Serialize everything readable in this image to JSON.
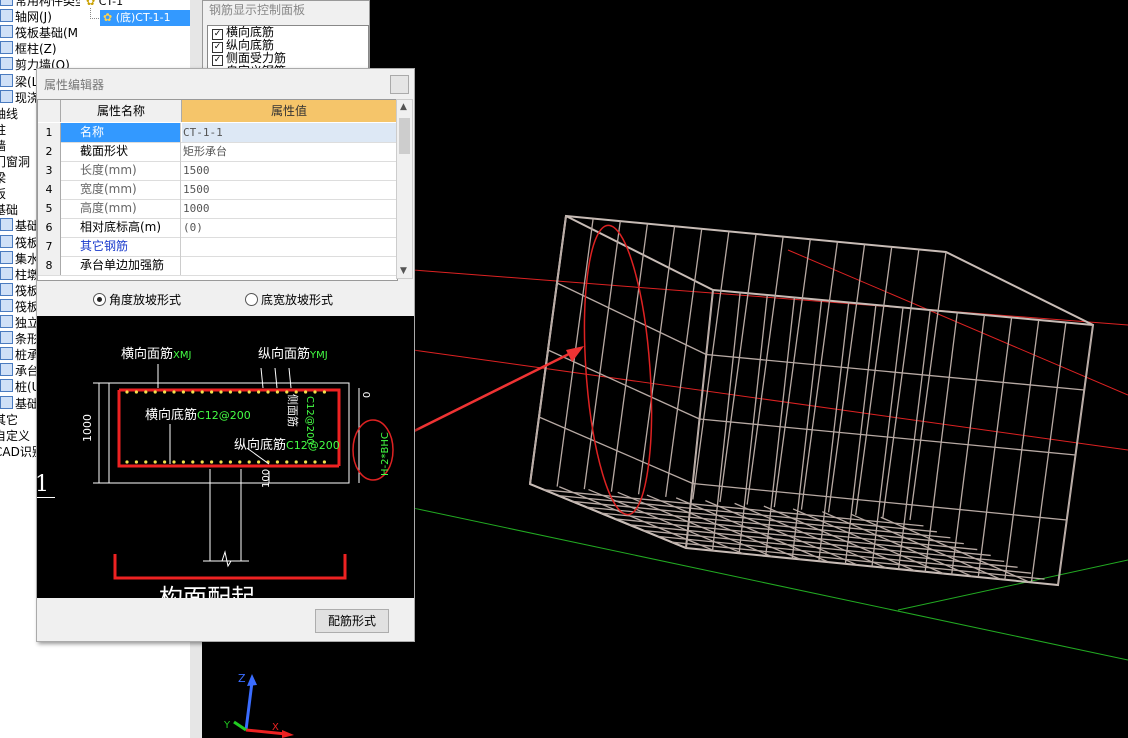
{
  "tree": {
    "items": [
      {
        "label": "常用构件类型",
        "icon": "folder-icon"
      },
      {
        "label": "轴网(J)",
        "icon": "grid-icon"
      },
      {
        "label": "筏板基础(M",
        "icon": "raft-foundation-icon"
      },
      {
        "label": "框柱(Z)",
        "icon": "column-icon"
      },
      {
        "label": "剪力墙(Q)",
        "icon": "shear-wall-icon"
      },
      {
        "label": "梁(L)",
        "icon": "beam-icon"
      },
      {
        "label": "现浇",
        "icon": "slab-icon"
      },
      {
        "label": "轴线",
        "icon": ""
      },
      {
        "label": "柱",
        "icon": ""
      },
      {
        "label": "墙",
        "icon": ""
      },
      {
        "label": "门窗洞",
        "icon": ""
      },
      {
        "label": "梁",
        "icon": ""
      },
      {
        "label": "板",
        "icon": ""
      },
      {
        "label": "基础",
        "icon": ""
      },
      {
        "label": "基础",
        "icon": "foundation-icon"
      },
      {
        "label": "筏板",
        "icon": "raft-icon"
      },
      {
        "label": "集水",
        "icon": "sump-icon"
      },
      {
        "label": "柱墩",
        "icon": "pier-icon"
      },
      {
        "label": "筏板",
        "icon": "raft-icon"
      },
      {
        "label": "筏板",
        "icon": "raft-icon"
      },
      {
        "label": "独立",
        "icon": "isolated-footing-icon"
      },
      {
        "label": "条形",
        "icon": "strip-footing-icon"
      },
      {
        "label": "桩承",
        "icon": "pile-cap-icon"
      },
      {
        "label": "承台",
        "icon": "cap-icon"
      },
      {
        "label": "桩(U",
        "icon": "pile-icon"
      },
      {
        "label": "基础",
        "icon": "foundation-icon"
      },
      {
        "label": "其它",
        "icon": ""
      },
      {
        "label": "自定义",
        "icon": ""
      },
      {
        "label": "CAD识别",
        "icon": ""
      }
    ]
  },
  "tree2": {
    "root": "CT-1",
    "selected": "(底)CT-1-1"
  },
  "rebar_panel": {
    "title": "钢筋显示控制面板",
    "items": [
      "横向底筋",
      "纵向底筋",
      "侧面受力筋",
      "自定义钢筋一"
    ]
  },
  "editor": {
    "title": "属性编辑器",
    "col_name": "属性名称",
    "col_value": "属性值",
    "rows": [
      {
        "n": "1",
        "name": "名称",
        "value": "CT-1-1"
      },
      {
        "n": "2",
        "name": "截面形状",
        "value": "矩形承台"
      },
      {
        "n": "3",
        "name": "长度(mm)",
        "value": "1500"
      },
      {
        "n": "4",
        "name": "宽度(mm)",
        "value": "1500"
      },
      {
        "n": "5",
        "name": "高度(mm)",
        "value": "1000"
      },
      {
        "n": "6",
        "name": "相对底标高(m)",
        "value": "(0)"
      },
      {
        "n": "7",
        "name": "其它钢筋",
        "value": ""
      },
      {
        "n": "8",
        "name": "承台单边加强筋",
        "value": ""
      }
    ],
    "radio_1": "角度放坡形式",
    "radio_2": "底宽放坡形式",
    "config_button": "配筋形式",
    "colors": {
      "header_value_bg": "#f5c56a",
      "selected_row": "#3399ff",
      "link_text": "#1a3acc"
    }
  },
  "preview": {
    "label_top_h": "横向面筋",
    "label_top_h_code": "XMJ",
    "label_top_v": "纵向面筋",
    "label_top_v_code": "YMJ",
    "label_bottom_h": "横向底筋",
    "label_bottom_h_code": "C12@200",
    "label_bottom_v": "纵向底筋",
    "label_bottom_v_code": "C12@200",
    "label_side": "侧面筋",
    "label_side_code": "C12@200",
    "label_formula": "H-2*BHC",
    "dim_height": "1000",
    "dim_zero": "0",
    "dim_100": "100",
    "bottom_text": "构面配起",
    "left_mark": "1"
  },
  "axes": {
    "z": "Z",
    "x": "X",
    "y": "Y"
  }
}
